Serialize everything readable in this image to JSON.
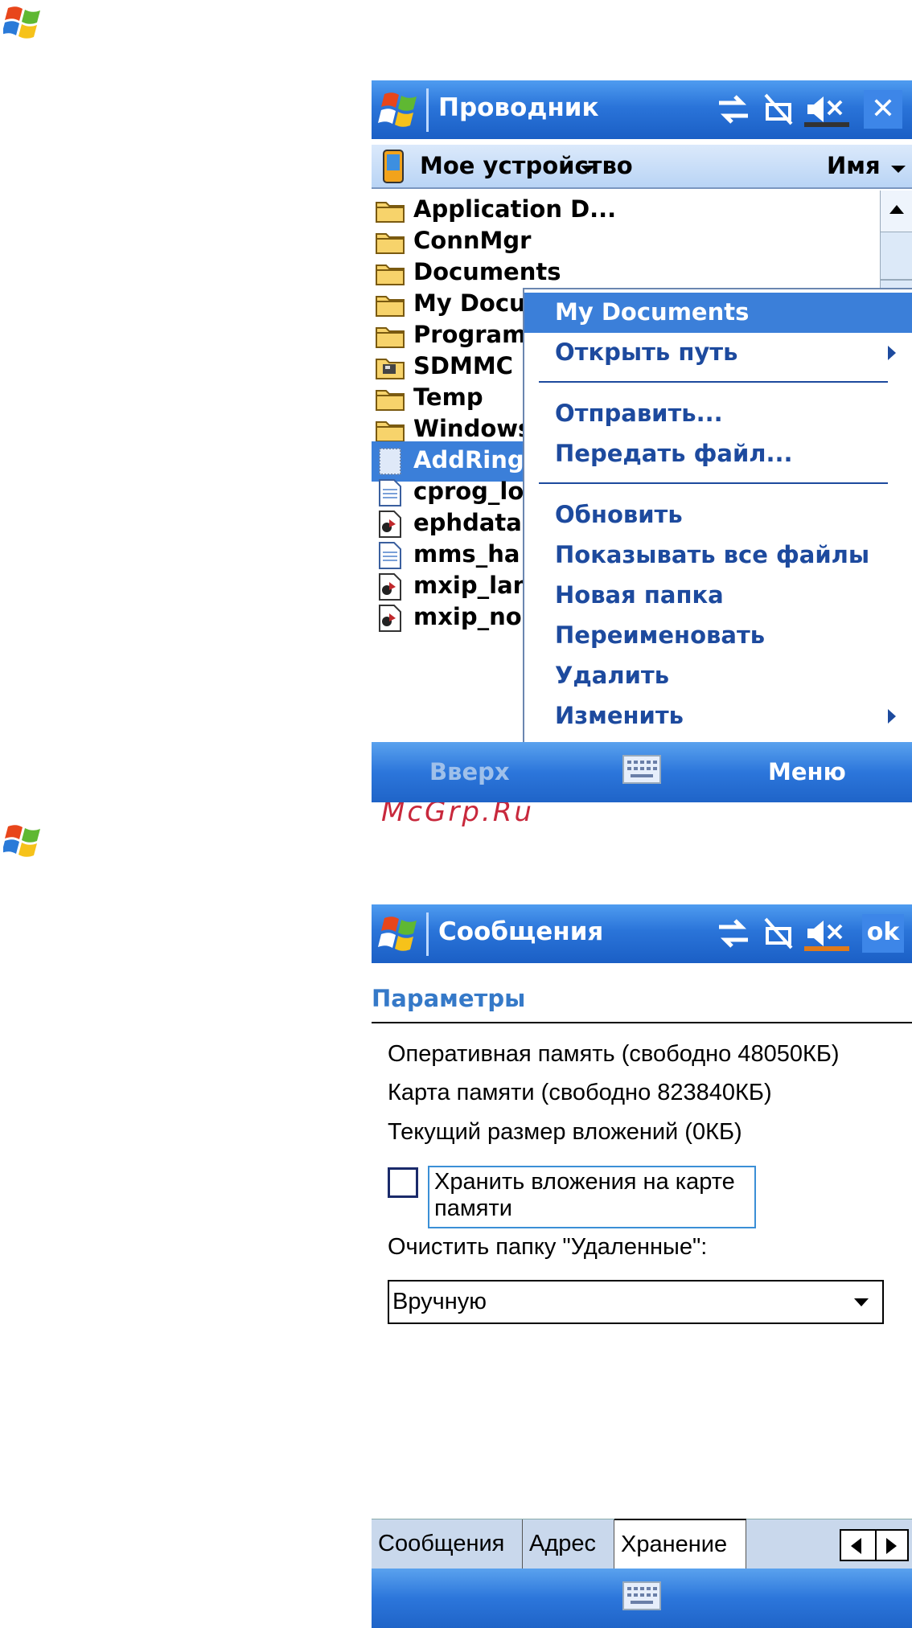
{
  "watermark": "McGrp.Ru",
  "explorer": {
    "title": "Проводник",
    "location": "Мое устройство",
    "sort": "Имя",
    "files": [
      {
        "name": "Application D...",
        "icon": "folder-icon"
      },
      {
        "name": "ConnMgr",
        "icon": "folder-icon"
      },
      {
        "name": "Documents",
        "icon": "folder-icon"
      },
      {
        "name": "My Documents",
        "icon": "folder-icon"
      },
      {
        "name": "Program Files",
        "icon": "folder-icon"
      },
      {
        "name": "SDMMC",
        "icon": "storage-card-icon"
      },
      {
        "name": "Temp",
        "icon": "folder-icon"
      },
      {
        "name": "Windows",
        "icon": "folder-icon"
      },
      {
        "name": "AddRing",
        "icon": "file-icon"
      },
      {
        "name": "cprog_log",
        "icon": "text-file-icon"
      },
      {
        "name": "ephdata",
        "icon": "media-file-icon"
      },
      {
        "name": "mms_ha",
        "icon": "text-file-icon"
      },
      {
        "name": "mxip_lang",
        "icon": "media-file-icon"
      },
      {
        "name": "mxip_no",
        "icon": "media-file-icon"
      }
    ],
    "context_menu": [
      "My Documents",
      "Открыть путь",
      "Отправить...",
      "Передать файл...",
      "Обновить",
      "Показывать все файлы",
      "Новая папка",
      "Переименовать",
      "Удалить",
      "Изменить"
    ],
    "softkey_left": "Вверх",
    "softkey_right": "Меню"
  },
  "messaging": {
    "title": "Сообщения",
    "ok_label": "ok",
    "header": "Параметры",
    "ram_info": "Оперативная память (свободно 48050КБ)",
    "card_info": "Карта памяти (свободно 823840КБ)",
    "attach_info": "Текущий размер вложений (0КБ)",
    "store_on_card_label": "Хранить вложения на карте памяти",
    "store_on_card_checked": false,
    "empty_deleted_label": "Очистить папку \"Удаленные\":",
    "empty_deleted_value": "Вручную",
    "tabs": [
      "Сообщения",
      "Адрес",
      "Хранение"
    ],
    "active_tab": "Хранение"
  }
}
